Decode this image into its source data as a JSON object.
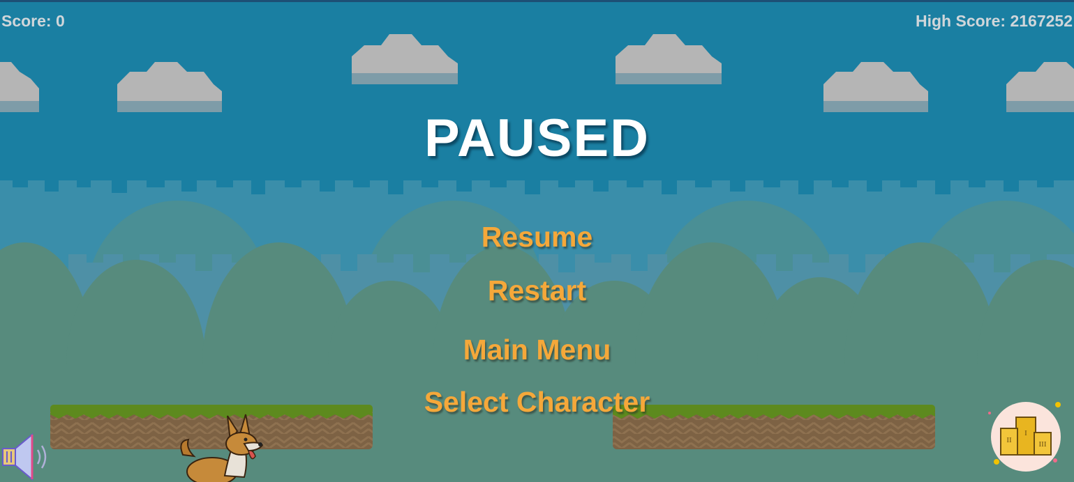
{
  "hud": {
    "score_label": "Score: 0",
    "high_score_label": "High Score: 2167252"
  },
  "pause_menu": {
    "title": "PAUSED",
    "buttons": {
      "resume": "Resume",
      "restart": "Restart",
      "main_menu": "Main Menu",
      "select_character": "Select Character"
    }
  },
  "icons": {
    "sound": "speaker-icon",
    "leaderboard": "podium-icon",
    "player": "corgi-dog-character"
  },
  "leaderboard_podium_numerals": [
    "I",
    "II",
    "III"
  ],
  "colors": {
    "sky": "#1a7fa2",
    "menu_text": "#f5a83a",
    "title_text": "#ffffff",
    "hud_text": "#d0d6da",
    "grass": "#5d8a1e",
    "dirt": "#7a6040"
  }
}
